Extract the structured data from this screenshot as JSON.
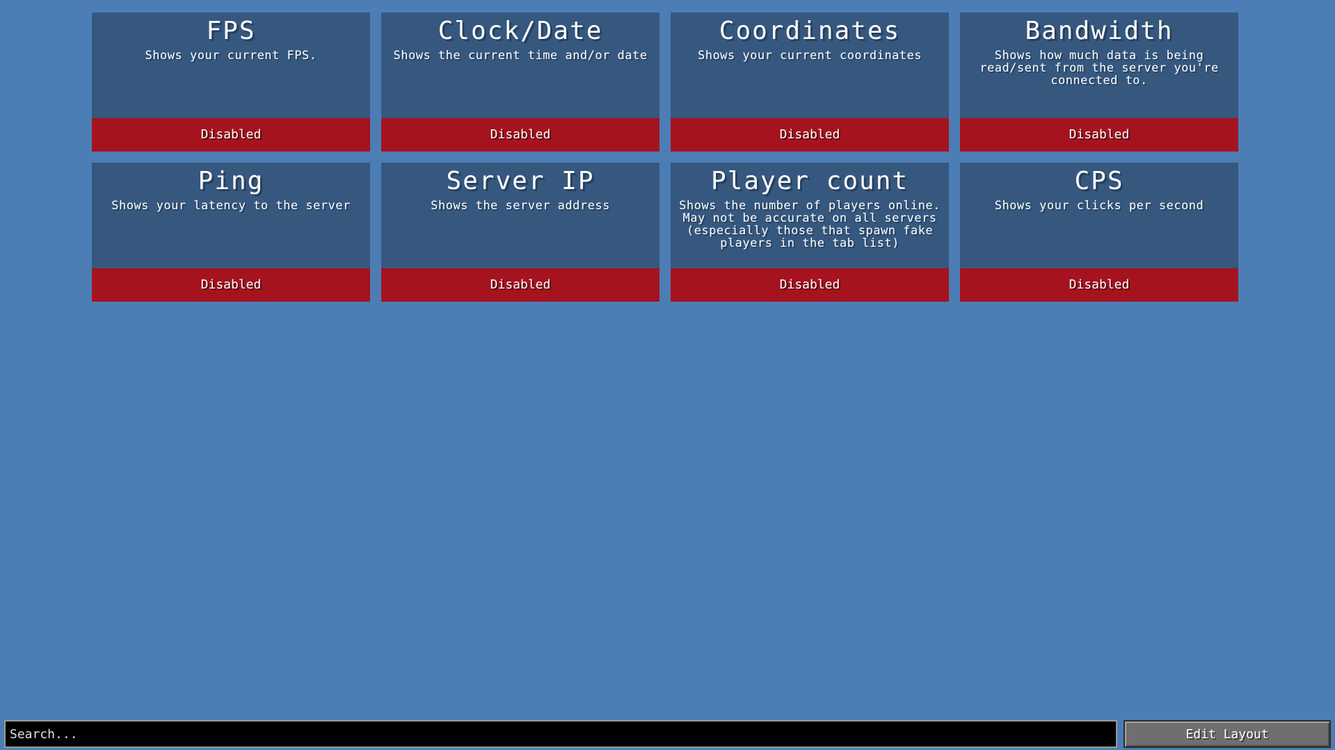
{
  "modules": [
    {
      "title": "FPS",
      "description": "Shows your current FPS.",
      "status": "Disabled"
    },
    {
      "title": "Clock/Date",
      "description": "Shows the current time and/or date",
      "status": "Disabled"
    },
    {
      "title": "Coordinates",
      "description": "Shows your current coordinates",
      "status": "Disabled"
    },
    {
      "title": "Bandwidth",
      "description": "Shows how much data is being read/sent from the server you're connected to.",
      "status": "Disabled"
    },
    {
      "title": "Ping",
      "description": "Shows your latency to the server",
      "status": "Disabled"
    },
    {
      "title": "Server IP",
      "description": "Shows the server address",
      "status": "Disabled"
    },
    {
      "title": "Player count",
      "description": "Shows the number of players online. May not be accurate on all servers (especially those that spawn fake players in the tab list)",
      "status": "Disabled"
    },
    {
      "title": "CPS",
      "description": "Shows your clicks per second",
      "status": "Disabled"
    }
  ],
  "search": {
    "placeholder": "Search...",
    "value": ""
  },
  "edit_layout": {
    "label": "Edit Layout"
  },
  "colors": {
    "background": "#4d7db5",
    "card": "#36587f",
    "disabled": "#a5131f"
  }
}
